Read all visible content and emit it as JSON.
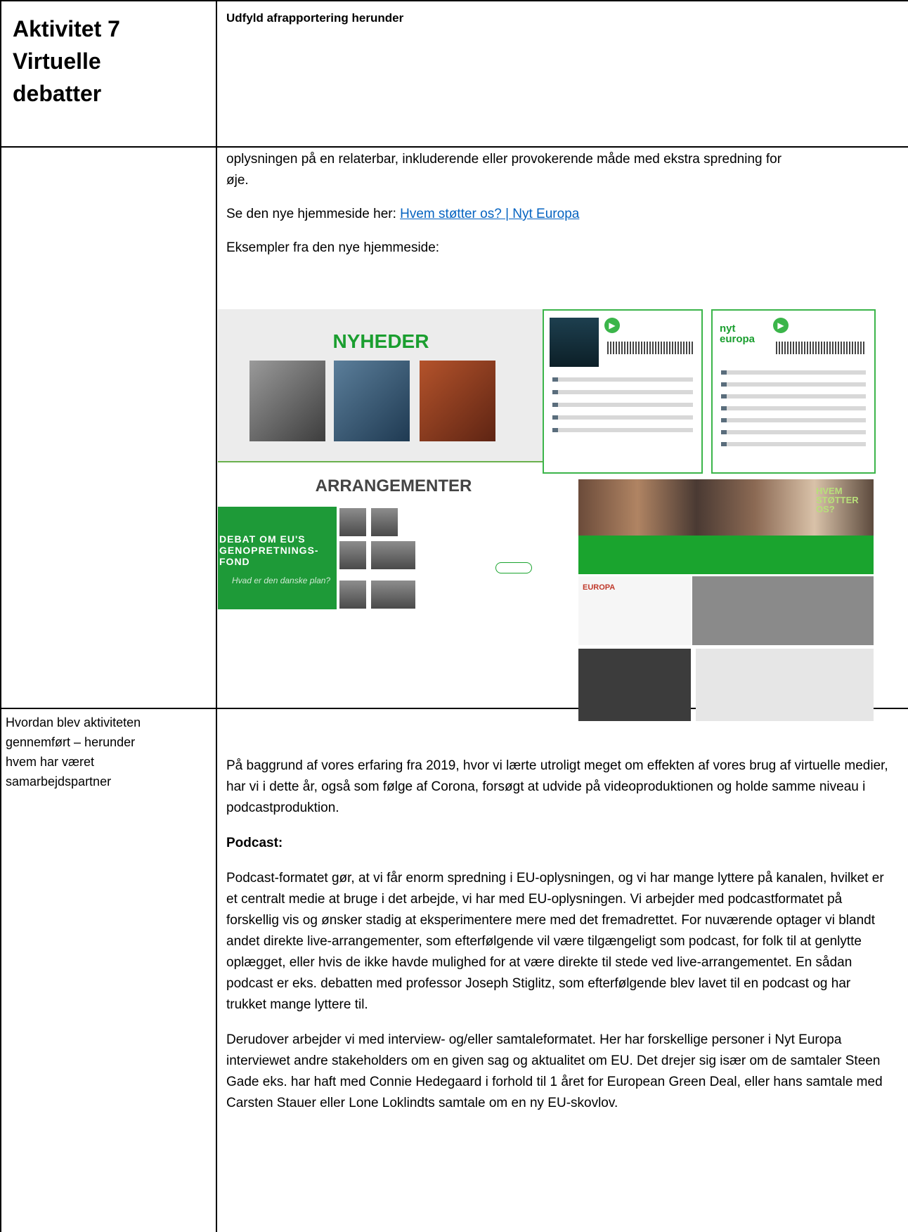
{
  "header": {
    "title_lines": [
      "Aktivitet 7",
      "Virtuelle",
      "debatter"
    ],
    "instruction": "Udfyld afrapportering herunder"
  },
  "continuation": {
    "line1": "oplysningen på en relaterbar, inkluderende eller provokerende måde med ekstra spredning for",
    "line2": "øje.",
    "see_prefix": "Se den nye hjemmeside her: ",
    "see_link": "Hvem støtter os? | Nyt Europa",
    "examples": "Eksempler fra den nye hjemmeside:"
  },
  "collage": {
    "news_title": "NYHEDER",
    "events_title": "ARRANGEMENTER",
    "debat_title": "DEBAT OM EU'S GENOPRETNINGS- FOND",
    "debat_sub": "Hvad er den danske plan?",
    "supporters_title": "HVEM STØTTER OS?",
    "logo_text": "nyt europa",
    "eu_logo": "EUROPA"
  },
  "row2": {
    "label_lines": [
      "Hvordan blev aktiviteten",
      "gennemført – herunder",
      "hvem har været",
      "samarbejdspartner"
    ],
    "p1": "På baggrund af vores erfaring fra 2019, hvor vi lærte utroligt meget om effekten af vores brug af virtuelle medier, har vi i dette år, også som følge af Corona, forsøgt at udvide på videoproduktionen og holde samme niveau i podcastproduktion.",
    "podcast_heading": "Podcast:",
    "p2": "Podcast-formatet gør, at vi får enorm spredning i EU-oplysningen, og vi har mange lyttere på kanalen, hvilket er et centralt medie at bruge i det arbejde, vi har med EU-oplysningen. Vi arbejder med podcastformatet på forskellig vis og ønsker stadig at eksperimentere mere med det fremadrettet. For nuværende optager vi blandt andet direkte live-arrangementer, som efterfølgende vil være tilgængeligt som podcast, for folk til at genlytte oplægget, eller hvis de ikke havde mulighed for at være direkte til stede ved live-arrangementet. En sådan podcast er eks. debatten med professor Joseph Stiglitz, som efterfølgende blev lavet til en podcast og har trukket mange lyttere til.",
    "p3": "Derudover arbejder vi med interview- og/eller samtaleformatet. Her har forskellige personer i Nyt Europa interviewet andre stakeholders om en given sag og aktualitet om EU. Det drejer sig især om de samtaler Steen Gade eks. har haft med Connie Hedegaard i forhold til 1 året for European Green Deal, eller hans samtale med Carsten Stauer eller Lone Loklindts samtale om en ny EU-skovlov."
  }
}
